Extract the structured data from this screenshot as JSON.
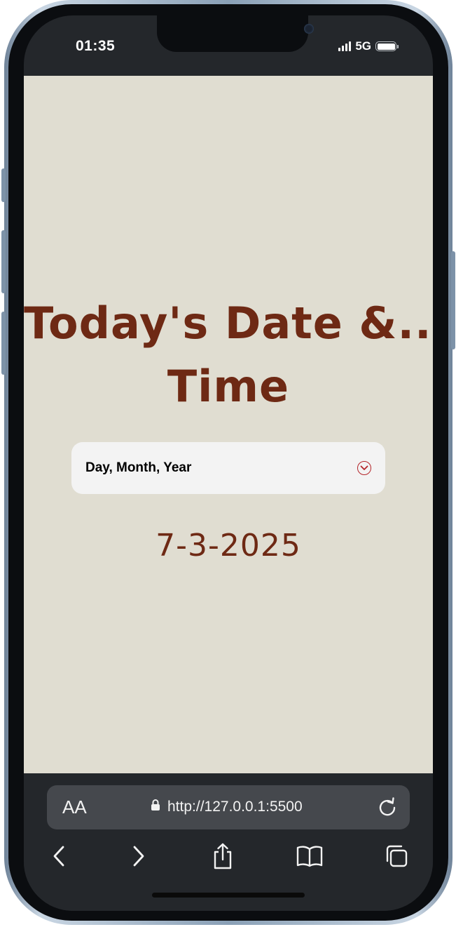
{
  "status_bar": {
    "time": "01:35",
    "network": "5G",
    "icons": [
      "signal-icon",
      "battery-icon"
    ]
  },
  "page": {
    "heading_line1": "Today's Date &....",
    "heading_line2": "Time",
    "select": {
      "selected": "Day, Month, Year",
      "icon": "chevron-down-circle-icon"
    },
    "date_value": "7-3-2025",
    "colors": {
      "background": "#e0ddd1",
      "accent_text": "#6e2914",
      "select_background": "#f3f3f3",
      "chevron": "#b4252a"
    }
  },
  "browser": {
    "text_size_label": "AA",
    "url": "http://127.0.0.1:5500",
    "icons": [
      "lock-icon",
      "reload-icon",
      "back-icon",
      "forward-icon",
      "share-icon",
      "bookmarks-icon",
      "tabs-icon"
    ]
  }
}
